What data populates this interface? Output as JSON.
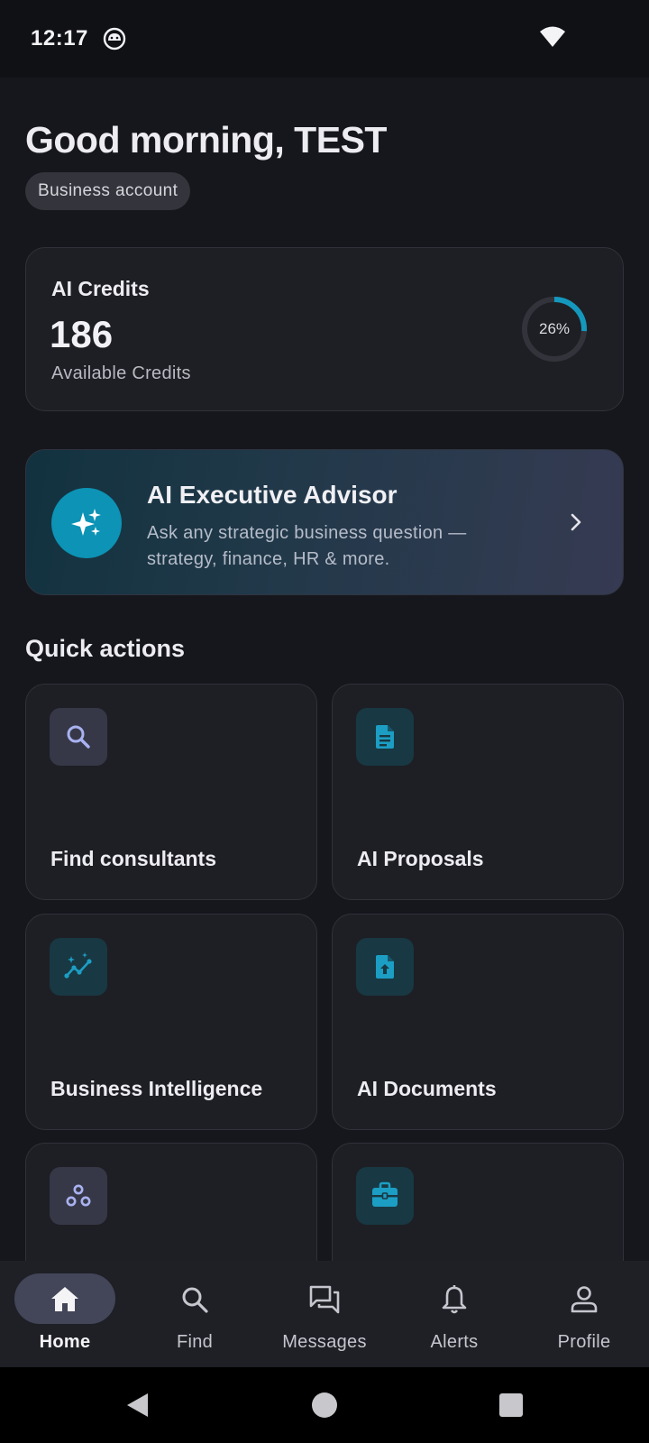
{
  "status_bar": {
    "time": "12:17",
    "app_icon": "android-robot-icon",
    "signal_icon": "wifi-icon"
  },
  "header": {
    "greeting": "Good morning, TEST",
    "account_type": "Business account"
  },
  "credits": {
    "title": "AI Credits",
    "value": "186",
    "subtitle": "Available Credits",
    "percent_label": "26%",
    "percent": 26,
    "ring_color": "#1498be",
    "track_color": "#33343b"
  },
  "advisor": {
    "title": "AI Executive Advisor",
    "description": "Ask any strategic business question — strategy, finance, HR & more.",
    "icon": "sparkles-icon"
  },
  "quick_actions": {
    "heading": "Quick actions",
    "tiles": [
      {
        "label": "Find consultants",
        "icon": "search-icon"
      },
      {
        "label": "AI Proposals",
        "icon": "document-icon"
      },
      {
        "label": "Business Intelligence",
        "icon": "analytics-icon"
      },
      {
        "label": "AI Documents",
        "icon": "file-upload-icon"
      },
      {
        "label": "",
        "icon": "network-icon"
      },
      {
        "label": "",
        "icon": "briefcase-icon"
      }
    ]
  },
  "bottom_nav": {
    "items": [
      {
        "label": "Home",
        "icon": "home-icon",
        "active": true
      },
      {
        "label": "Find",
        "icon": "search-icon"
      },
      {
        "label": "Messages",
        "icon": "chat-icon"
      },
      {
        "label": "Alerts",
        "icon": "bell-icon"
      },
      {
        "label": "Profile",
        "icon": "person-icon"
      }
    ]
  },
  "colors": {
    "accent": "#0c93b5",
    "icon_teal": "#1c9ec4",
    "icon_slate": "#a9b2f0",
    "background": "#16171c"
  }
}
